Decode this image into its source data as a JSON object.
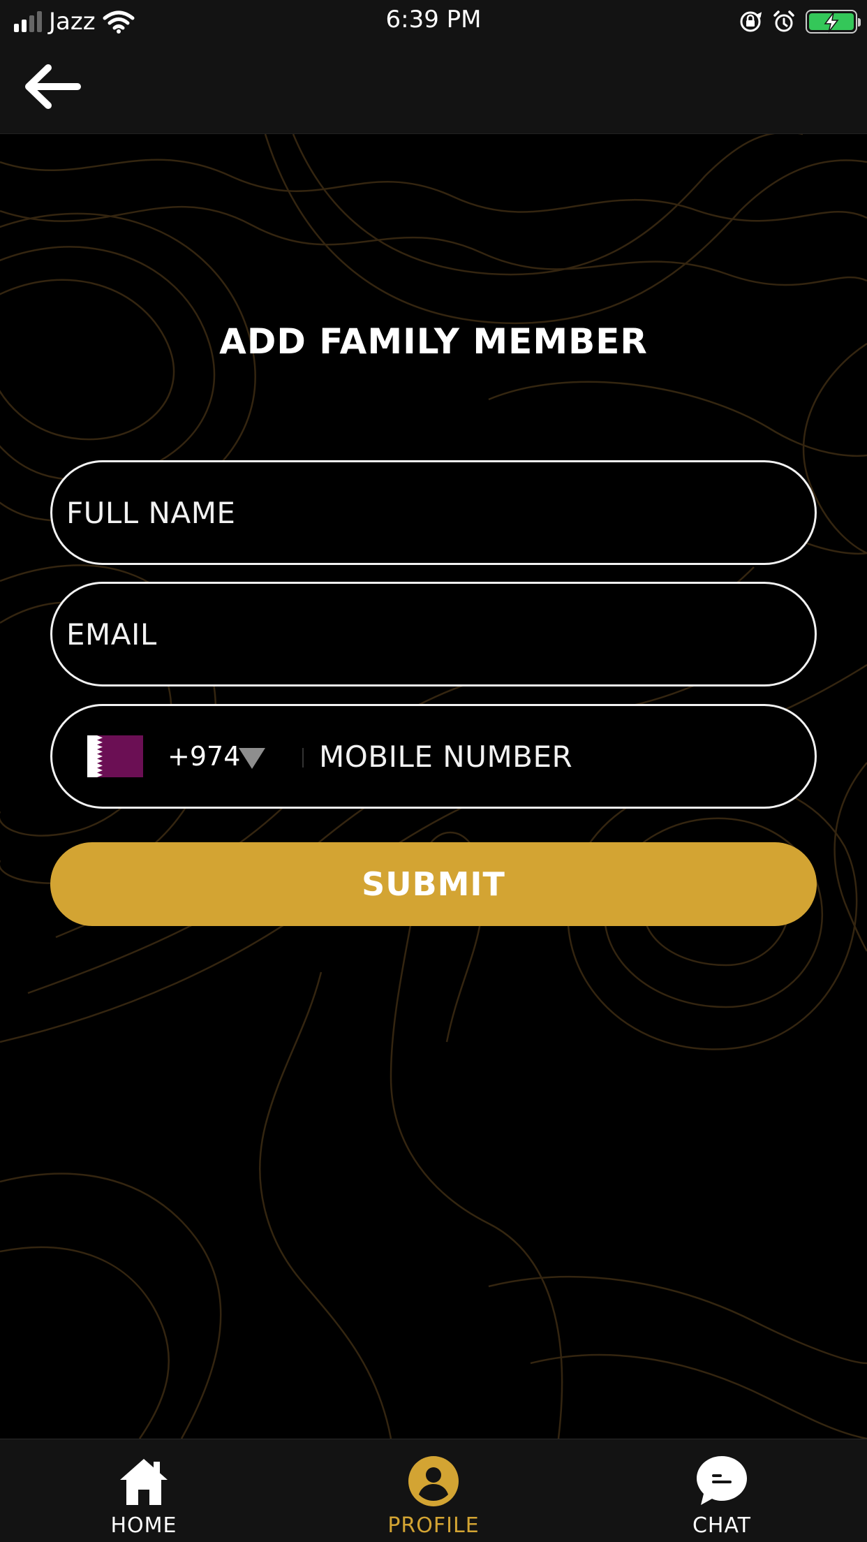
{
  "status_bar": {
    "carrier": "Jazz",
    "time": "6:39 PM"
  },
  "page": {
    "title": "ADD FAMILY MEMBER"
  },
  "form": {
    "full_name_placeholder": "FULL NAME",
    "email_placeholder": "EMAIL",
    "country_code": "+974",
    "mobile_placeholder": "MOBILE NUMBER",
    "submit_label": "SUBMIT"
  },
  "tabs": [
    {
      "label": "HOME",
      "icon": "home-icon",
      "active": false
    },
    {
      "label": "PROFILE",
      "icon": "person-icon",
      "active": true
    },
    {
      "label": "CHAT",
      "icon": "chat-icon",
      "active": false
    }
  ],
  "colors": {
    "accent": "#d3a433",
    "background": "#000000",
    "bar": "#131313",
    "battery": "#34c759",
    "flag_maroon": "#6b0f54"
  }
}
